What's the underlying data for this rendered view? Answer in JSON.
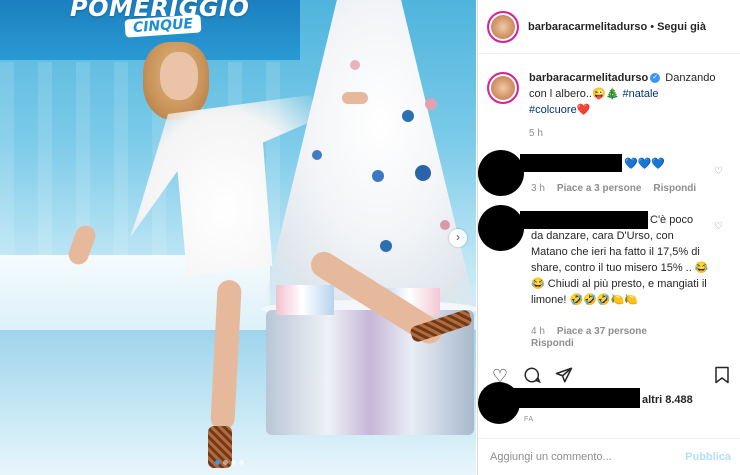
{
  "photo": {
    "show_logo_top": "POMERIGGIO",
    "show_logo_bottom": "CINQUE",
    "carousel_next_icon": "chevron-right-icon",
    "carousel_next_glyph": "›",
    "carousel_dots": 4,
    "carousel_active_dot": 0
  },
  "header": {
    "username": "barbaracarmelitadurso",
    "separator": "•",
    "follow_label": "Segui già",
    "more_glyph": "···"
  },
  "caption": {
    "username": "barbaracarmelitadurso",
    "verified_glyph": "✓",
    "text": "Danzando con l albero..",
    "emojis": "😜🎄",
    "hashtag1": "#natale",
    "hashtag2": "#colcuore",
    "heart_emoji": "❤️",
    "time": "5 h"
  },
  "comments": [
    {
      "text": "💙💙💙",
      "time": "3 h",
      "likes": "Piace a 3 persone",
      "reply": "Rispondi"
    },
    {
      "text_line1": "C'è poco",
      "text_rest": "da danzare, cara D'Urso, con Matano che ieri ha fatto il 17,5% di share, contro il tuo misero 15% .. 😂😂 Chiudi al più presto, e mangiati il limone! 🤣🤣🤣🍋🍋",
      "time": "4 h",
      "likes": "Piace a 37 persone",
      "reply": "Rispondi"
    }
  ],
  "actions": {
    "like_icon": "heart-icon",
    "comment_icon": "comment-icon",
    "share_icon": "share-icon",
    "save_icon": "bookmark-icon"
  },
  "likes": {
    "text": "altri 8.488",
    "date": "FA"
  },
  "add_comment": {
    "placeholder": "Aggiungi un commento...",
    "post_label": "Pubblica"
  },
  "colors": {
    "link": "#00376b",
    "accent_blue": "#3897f0",
    "muted": "#8e8e8e",
    "post_disabled": "#b2dffc"
  }
}
